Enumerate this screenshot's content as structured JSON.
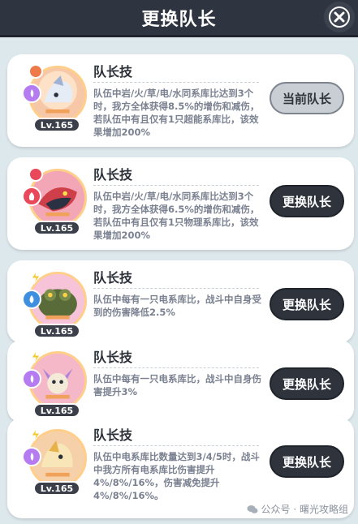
{
  "header": {
    "title": "更换队长",
    "close_icon": "close-icon"
  },
  "cards": [
    {
      "level": "Lv.165",
      "element": "dragon-element-icon",
      "element_color": "#b57cf2",
      "skill_title": "队长技",
      "skill_desc": "队伍中岩/火/草/电/水同系库比达到3个时，我方全体获得8.5%的增伤和减伤，若队伍中有且仅有1只超能系库比，该效果增加200%",
      "button": "当前队长",
      "current": true,
      "avatar_bg": "#f7c8a8"
    },
    {
      "level": "Lv.165",
      "element": "fire-element-icon",
      "element_color": "#e9485a",
      "skill_title": "队长技",
      "skill_desc": "队伍中岩/火/草/电/水同系库比达到3个时，我方全体获得6.5%的增伤和减伤，若队伍中有且仅有1只物理系库比，该效果增加200%",
      "button": "更换队长",
      "current": false,
      "avatar_bg": "#f2a6b6"
    },
    {
      "level": "Lv.165",
      "element": "water-element-icon",
      "element_color": "#3f8fe0",
      "skill_title": "队长技",
      "skill_desc": "队伍中每有一只电系库比，战斗中自身受到的伤害降低2.5%",
      "button": "更换队长",
      "current": false,
      "avatar_bg": "#f6c3d8"
    },
    {
      "level": "Lv.165",
      "element": "dragon-element-icon",
      "element_color": "#b57cf2",
      "skill_title": "队长技",
      "skill_desc": "队伍中每有一只电系库比，战斗中自身伤害提升3%",
      "button": "更换队长",
      "current": false,
      "avatar_bg": "#f4b8c8"
    },
    {
      "level": "Lv.165",
      "element": "dragon-element-icon",
      "element_color": "#b57cf2",
      "skill_title": "队长技",
      "skill_desc": "队伍中电系库比数量达到3/4/5时，战斗中我方所有电系库比伤害提升4%/8%/16%，伤害减免提升4%/8%/16%。",
      "button": "更换队长",
      "current": false,
      "avatar_bg": "#f6d0a8"
    }
  ],
  "watermark": "公众号 · 曙光攻略组"
}
